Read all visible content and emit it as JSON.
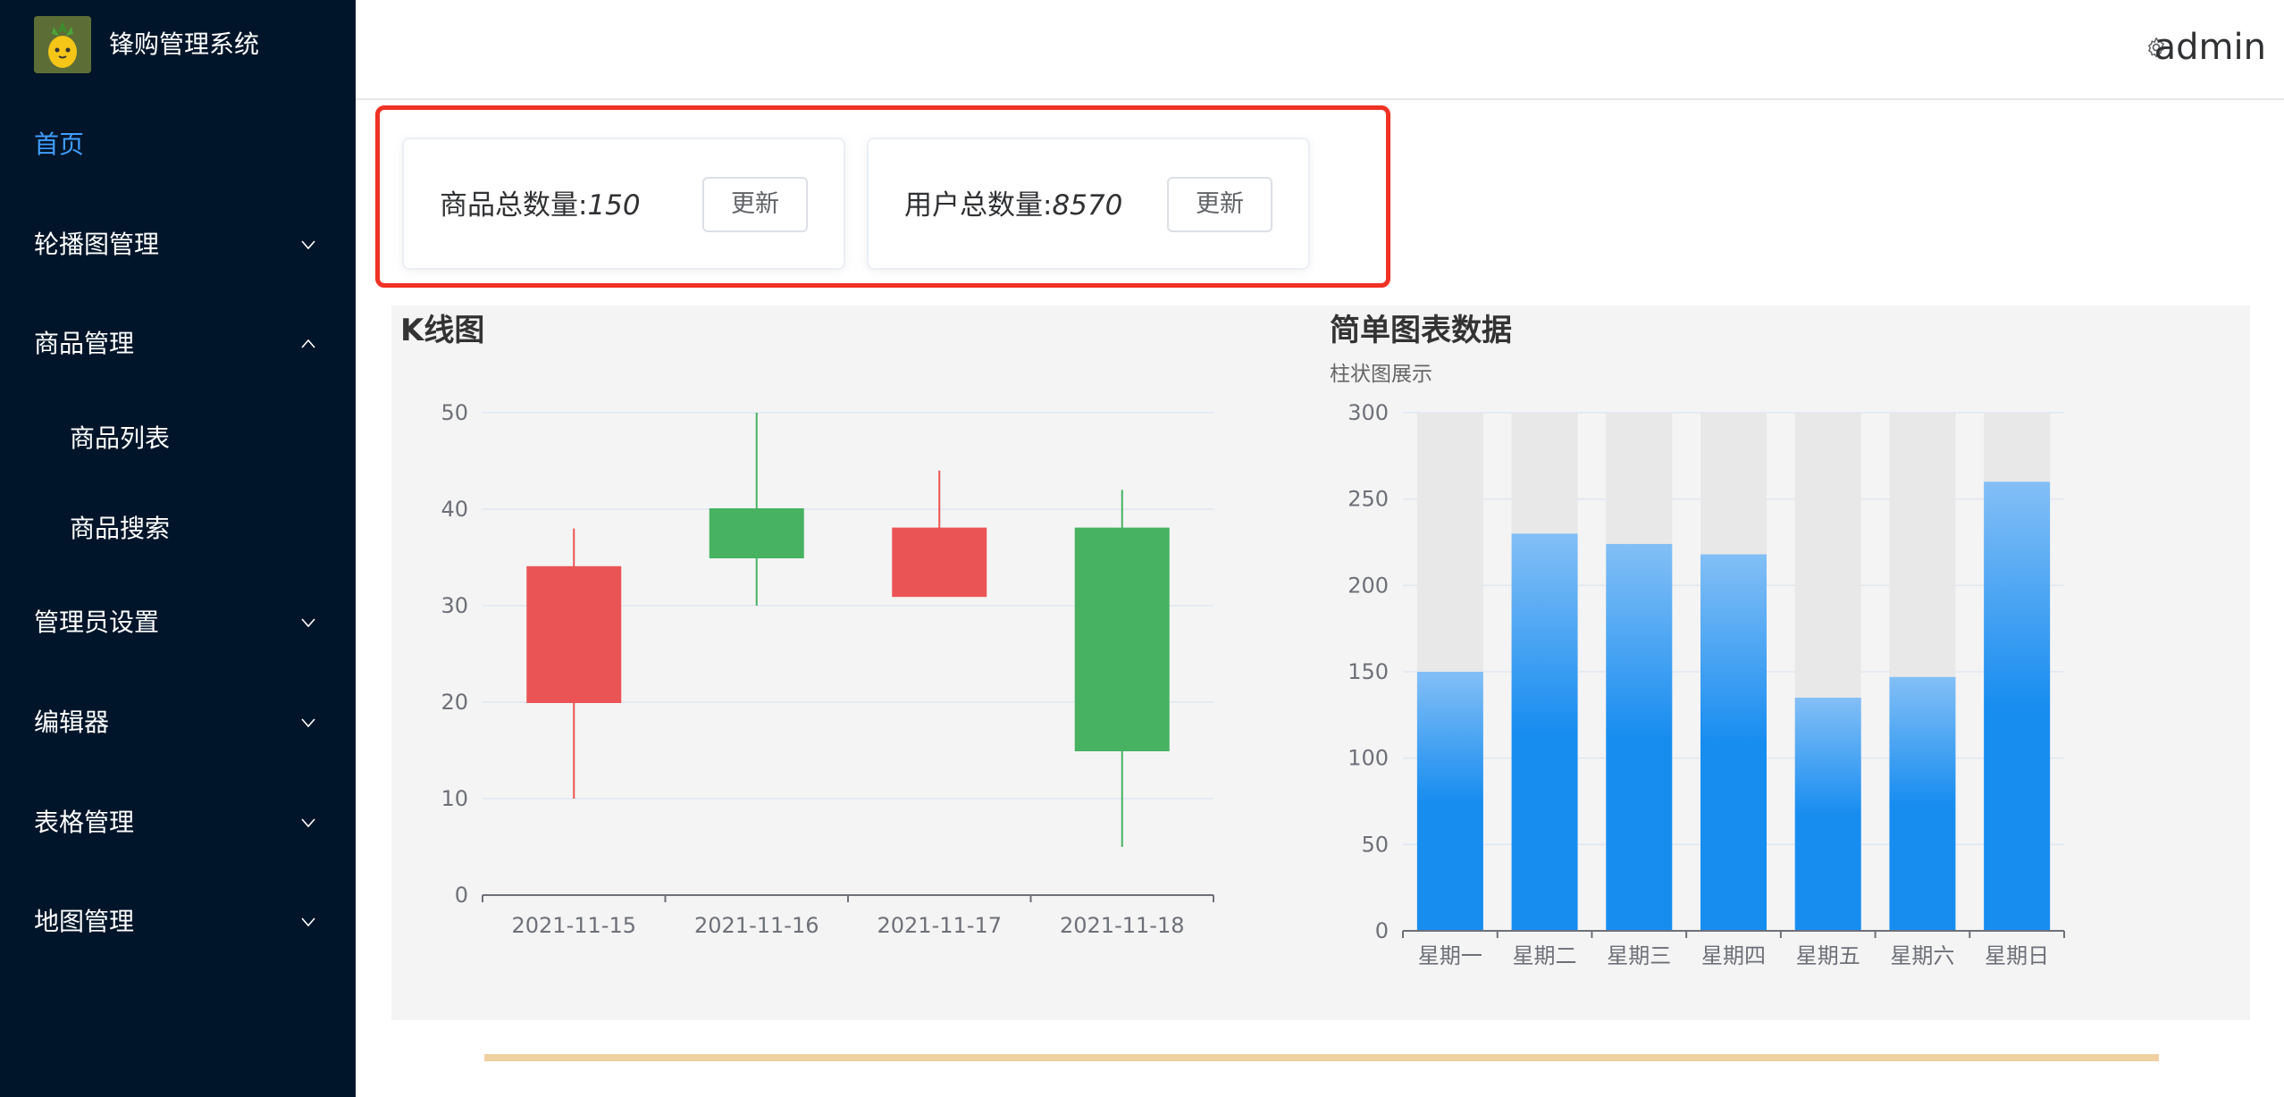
{
  "sidebar": {
    "app_title": "锋购管理系统",
    "items": [
      {
        "label": "首页",
        "active": true
      },
      {
        "label": "轮播图管理",
        "arrow": "down"
      },
      {
        "label": "商品管理",
        "arrow": "up"
      },
      {
        "label": "商品列表",
        "sub": true
      },
      {
        "label": "商品搜索",
        "sub": true
      },
      {
        "label": "管理员设置",
        "arrow": "down"
      },
      {
        "label": "编辑器",
        "arrow": "down"
      },
      {
        "label": "表格管理",
        "arrow": "down"
      },
      {
        "label": "地图管理",
        "arrow": "down"
      }
    ]
  },
  "header": {
    "user_name": "admin",
    "settings_icon": "gear-icon"
  },
  "stats": [
    {
      "label": "商品总数量:",
      "value": "150",
      "button": "更新"
    },
    {
      "label": "用户总数量:",
      "value": "8570",
      "button": "更新"
    }
  ],
  "colors": {
    "sidebar_bg": "#001529",
    "active_menu": "#409eff",
    "highlight_border": "#f03224",
    "candle_up": "#eb5454",
    "candle_down": "#47b262",
    "bar_fill": "#188df0",
    "bar_background": "#e8e8e8",
    "bottom_bar": "#efd0a0"
  },
  "chart_data": [
    {
      "type": "candlestick",
      "title": "K线图",
      "categories": [
        "2021-11-15",
        "2021-11-16",
        "2021-11-17",
        "2021-11-18"
      ],
      "ohlc": [
        {
          "open": 20,
          "close": 34,
          "low": 10,
          "high": 38
        },
        {
          "open": 40,
          "close": 35,
          "low": 30,
          "high": 50
        },
        {
          "open": 31,
          "close": 38,
          "low": 33,
          "high": 44
        },
        {
          "open": 38,
          "close": 15,
          "low": 5,
          "high": 42
        }
      ],
      "ylim": [
        0,
        50
      ],
      "yticks": [
        0,
        10,
        20,
        30,
        40,
        50
      ],
      "grid": true
    },
    {
      "type": "bar",
      "title": "简单图表数据",
      "subtitle": "柱状图展示",
      "categories": [
        "星期一",
        "星期二",
        "星期三",
        "星期四",
        "星期五",
        "星期六",
        "星期日"
      ],
      "values": [
        150,
        230,
        224,
        218,
        135,
        147,
        260
      ],
      "ylim": [
        0,
        300
      ],
      "yticks": [
        0,
        50,
        100,
        150,
        200,
        250,
        300
      ],
      "show_background": true,
      "grid": true
    }
  ]
}
